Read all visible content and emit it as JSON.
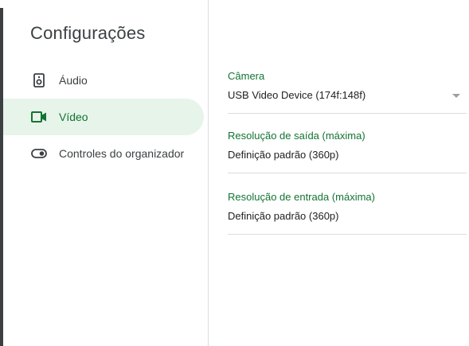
{
  "sidebar": {
    "title": "Configurações",
    "items": [
      {
        "label": "Áudio",
        "icon": "speaker-icon",
        "selected": false
      },
      {
        "label": "Vídeo",
        "icon": "videocam-icon",
        "selected": true
      },
      {
        "label": "Controles do organizador",
        "icon": "toggle-icon",
        "selected": false
      }
    ]
  },
  "video_settings": {
    "camera": {
      "label": "Câmera",
      "value": "USB Video Device (174f:148f)"
    },
    "send_resolution": {
      "label": "Resolução de saída (máxima)",
      "value": "Definição padrão (360p)"
    },
    "receive_resolution": {
      "label": "Resolução de entrada (máxima)",
      "value": "Definição padrão (360p)"
    }
  },
  "colors": {
    "accent": "#137333",
    "selected_background": "#e6f4ea",
    "divider": "#dadce0",
    "text": "#202124",
    "secondary_text": "#3c4043"
  }
}
